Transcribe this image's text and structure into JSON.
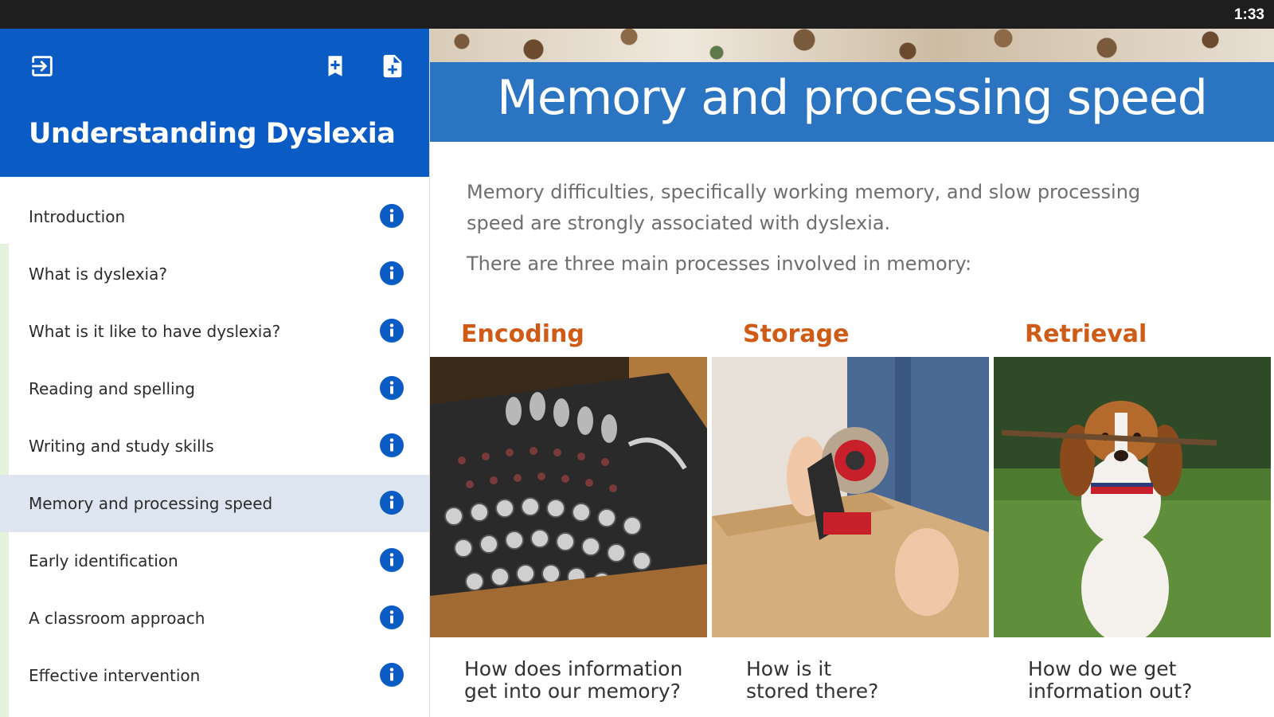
{
  "status_bar": {
    "time": "1:33"
  },
  "sidebar": {
    "title": "Understanding Dyslexia",
    "icons": [
      "exit-to-app-icon",
      "bookmark-add-icon",
      "note-add-icon"
    ],
    "items": [
      {
        "label": "Introduction"
      },
      {
        "label": "What is dyslexia?"
      },
      {
        "label": "What is it like to have dyslexia?"
      },
      {
        "label": "Reading and spelling"
      },
      {
        "label": "Writing and study skills"
      },
      {
        "label": "Memory and processing speed",
        "active": true
      },
      {
        "label": "Early identification"
      },
      {
        "label": "A classroom approach"
      },
      {
        "label": "Effective intervention"
      }
    ]
  },
  "main": {
    "title": "Memory and processing speed",
    "intro": "Memory difficulties, specifically working memory, and slow processing speed are strongly associated with dyslexia.",
    "intro2": "There are three main processes involved in memory:",
    "processes": [
      {
        "heading": "Encoding",
        "caption_line1": "How does information",
        "caption_line2": "get into our memory?",
        "image": "enigma-machine-photo"
      },
      {
        "heading": "Storage",
        "caption_line1": "How is it",
        "caption_line2": "stored there?",
        "image": "taping-box-photo"
      },
      {
        "heading": "Retrieval",
        "caption_line1": "How do we get",
        "caption_line2": "information out?",
        "image": "beagle-with-stick-photo"
      }
    ]
  },
  "colors": {
    "sidebar_header": "#0a5bc4",
    "title_band": "#2b74c1",
    "active_item": "#dde6f0",
    "process_heading": "#cf5b17",
    "info_icon": "#0a5bc4"
  }
}
